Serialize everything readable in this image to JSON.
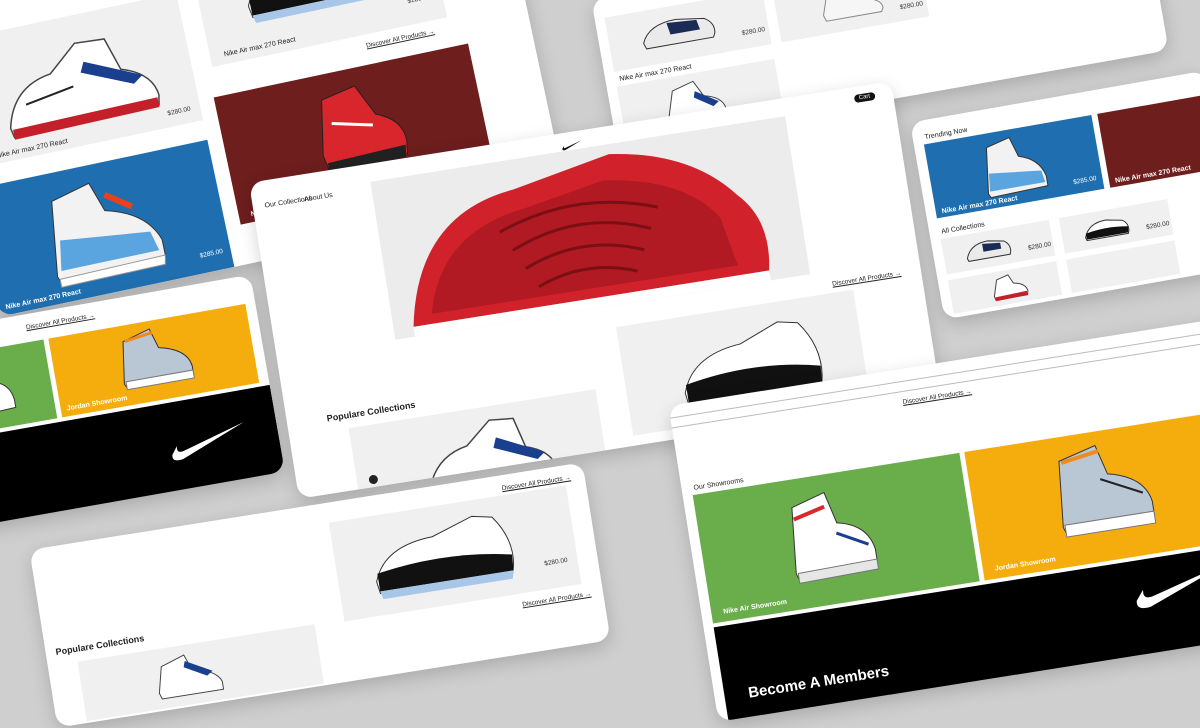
{
  "colors": {
    "background": "#cfcfcf",
    "blue": "#1f6fb0",
    "maroon": "#6d1e1d",
    "green": "#6aae4c",
    "yellow": "#f5ad0e",
    "black": "#000000"
  },
  "product": {
    "name": "Nike Air max 270 React",
    "price": "$280.00",
    "price_alt": "$285.00"
  },
  "nav": {
    "collections": "Our Collections",
    "about": "About Us",
    "cart": "Cart"
  },
  "sections": {
    "popular": "Populare Collections",
    "trending": "Trending Now",
    "all_collections": "All Collections",
    "showrooms": "Our Showrooms",
    "discover": "Discover All Products →",
    "become_member": "Become A Members",
    "air_showroom": "Nike Air Showroom",
    "jordan_showroom": "Jordan Showroom"
  },
  "icons": [
    "nike-swoosh-icon",
    "cart-icon",
    "next-arrow-icon",
    "shoe-image"
  ]
}
